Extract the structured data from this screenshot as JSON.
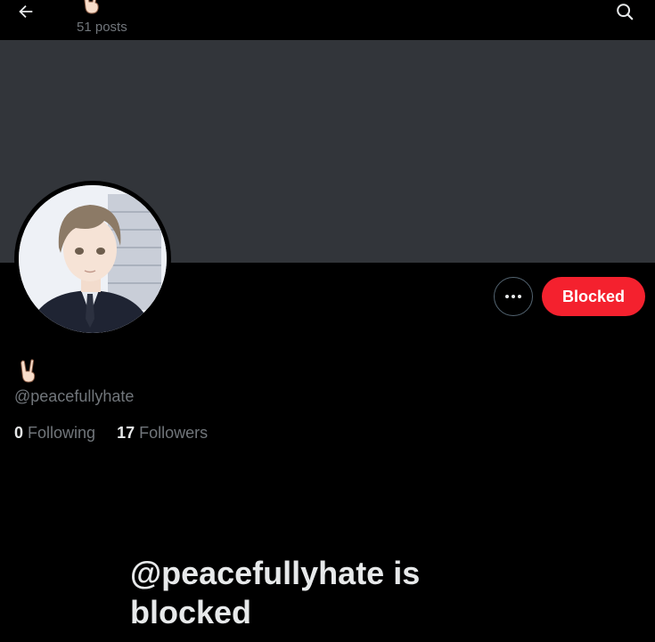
{
  "header": {
    "display_emoji": "✌",
    "post_count": "51 posts",
    "back_icon": "arrow-left-icon",
    "search_icon": "search-icon"
  },
  "profile": {
    "banner_color": "#32353a",
    "avatar_alt": "profile avatar",
    "display_name_emoji": "✌",
    "handle": "@peacefullyhate",
    "following_count": "0",
    "following_label": "Following",
    "followers_count": "17",
    "followers_label": "Followers"
  },
  "actions": {
    "more_icon": "more-dots-icon",
    "blocked_label": "Blocked",
    "blocked_color": "#f4212e"
  },
  "blocked_notice": {
    "title": "@peacefullyhate is blocked"
  }
}
